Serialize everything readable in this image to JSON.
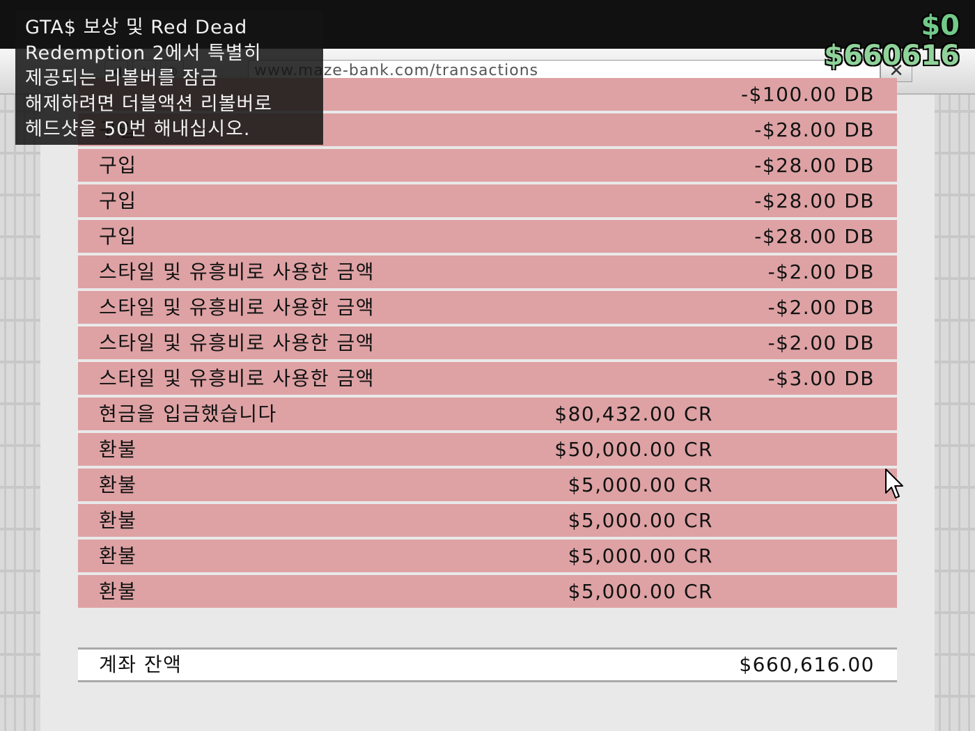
{
  "browser": {
    "url": "www.maze-bank.com/transactions",
    "close_label": "✕",
    "nav_icons": [
      "back-icon",
      "home-icon",
      "globe-icon"
    ]
  },
  "hud": {
    "wallet": "$0",
    "bank": "$660616"
  },
  "notification": {
    "lines": [
      "GTA$ 보상 및 Red Dead",
      "Redemption 2에서 특별히",
      "제공되는 리볼버를 잠금",
      "해제하려면 더블액션 리볼버로",
      "헤드샷을 50번 해내십시오."
    ]
  },
  "transactions": [
    {
      "desc": "",
      "credit": "",
      "debit": "-$100.00 DB"
    },
    {
      "desc": "구입",
      "credit": "",
      "debit": "-$28.00 DB"
    },
    {
      "desc": "구입",
      "credit": "",
      "debit": "-$28.00 DB"
    },
    {
      "desc": "구입",
      "credit": "",
      "debit": "-$28.00 DB"
    },
    {
      "desc": "구입",
      "credit": "",
      "debit": "-$28.00 DB"
    },
    {
      "desc": "스타일 및 유흥비로 사용한 금액",
      "credit": "",
      "debit": "-$2.00 DB"
    },
    {
      "desc": "스타일 및 유흥비로 사용한 금액",
      "credit": "",
      "debit": "-$2.00 DB"
    },
    {
      "desc": "스타일 및 유흥비로 사용한 금액",
      "credit": "",
      "debit": "-$2.00 DB"
    },
    {
      "desc": "스타일 및 유흥비로 사용한 금액",
      "credit": "",
      "debit": "-$3.00 DB"
    },
    {
      "desc": "현금을 입금했습니다",
      "credit": "$80,432.00 CR",
      "debit": ""
    },
    {
      "desc": "환불",
      "credit": "$50,000.00 CR",
      "debit": ""
    },
    {
      "desc": "환불",
      "credit": "$5,000.00 CR",
      "debit": ""
    },
    {
      "desc": "환불",
      "credit": "$5,000.00 CR",
      "debit": ""
    },
    {
      "desc": "환불",
      "credit": "$5,000.00 CR",
      "debit": ""
    },
    {
      "desc": "환불",
      "credit": "$5,000.00 CR",
      "debit": ""
    }
  ],
  "balance": {
    "label": "계좌 잔액",
    "value": "$660,616.00"
  },
  "colors": {
    "row_bg": "#dea2a4",
    "hud_green": "#72c98a",
    "page_bg": "#e9e9e9"
  }
}
